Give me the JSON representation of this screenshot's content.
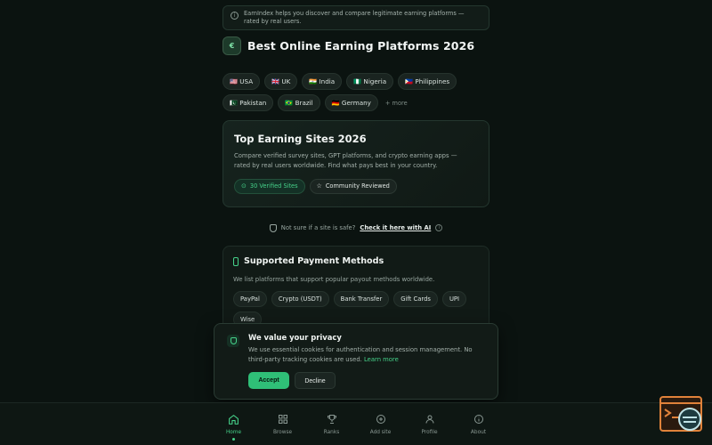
{
  "banner": {
    "text": "EarnIndex helps you discover and compare legitimate earning platforms — rated by real users."
  },
  "header": {
    "title": "Best Online Earning Platforms 2026"
  },
  "countries": {
    "row1": [
      "🇺🇸 USA",
      "🇬🇧 UK",
      "🇮🇳 India",
      "🇳🇬 Nigeria",
      "🇵🇭 Philippines"
    ],
    "row2": [
      "🇵🇰 Pakistan",
      "🇧🇷 Brazil",
      "🇩🇪 Germany"
    ],
    "more": "+ more"
  },
  "hero": {
    "title": "Top Earning Sites 2026",
    "description": "Compare verified survey sites, GPT platforms, and crypto earning apps — rated by real users worldwide. Find what pays best in your country.",
    "badge_verified": "30 Verified Sites",
    "badge_community": "Community Reviewed"
  },
  "safety": {
    "prompt": "Not sure if a site is safe?",
    "link": "Check it here with AI"
  },
  "payments": {
    "title": "Supported Payment Methods",
    "description": "We list platforms that support popular payout methods worldwide.",
    "methods": [
      "PayPal",
      "Crypto (USDT)",
      "Bank Transfer",
      "Gift Cards",
      "UPI",
      "Wise"
    ]
  },
  "cookie": {
    "title": "We value your privacy",
    "text": "We use essential cookies for authentication and session management. No third-party tracking cookies are used.",
    "learn_more": "Learn more",
    "accept": "Accept",
    "decline": "Decline"
  },
  "nav": {
    "home": "Home",
    "browse": "Browse",
    "ranks": "Ranks",
    "add_site": "Add site",
    "profile": "Profile",
    "about": "About"
  },
  "colors": {
    "accent": "#46d28a",
    "background": "#0b1310",
    "card": "#121c18",
    "widget": "#e0823a"
  }
}
